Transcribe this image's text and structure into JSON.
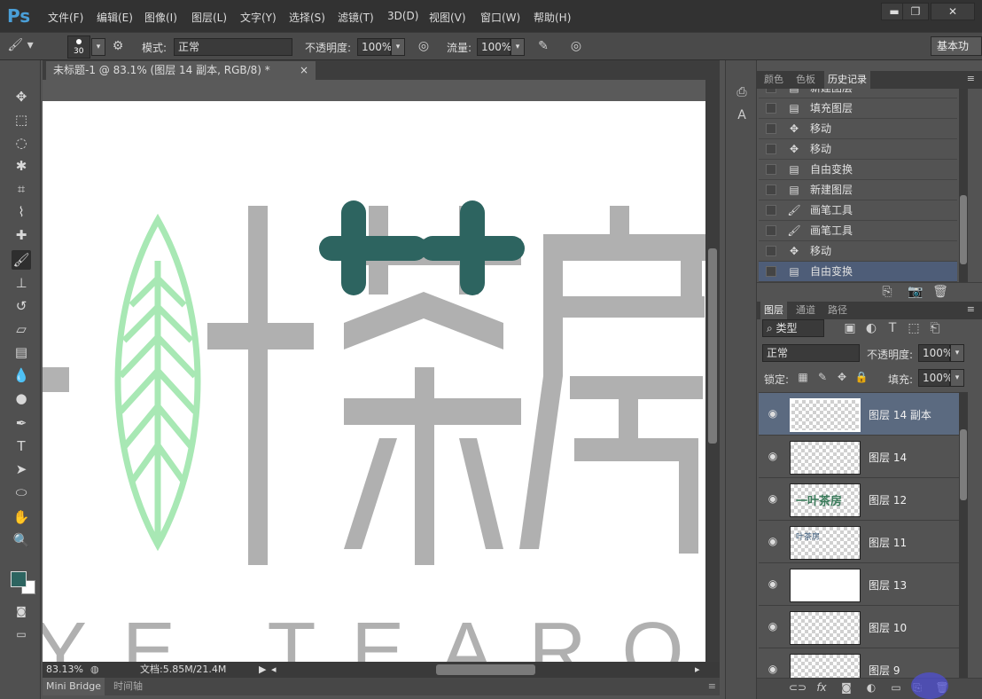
{
  "app": {
    "logo": "Ps"
  },
  "menu": [
    "文件(F)",
    "编辑(E)",
    "图像(I)",
    "图层(L)",
    "文字(Y)",
    "选择(S)",
    "滤镜(T)",
    "3D(D)",
    "视图(V)",
    "窗口(W)",
    "帮助(H)"
  ],
  "window_controls": {
    "minimize": "▬",
    "restore": "❐",
    "close": "✕"
  },
  "options": {
    "brush_size": "30",
    "mode_label": "模式:",
    "mode_value": "正常",
    "opacity_label": "不透明度:",
    "opacity_value": "100%",
    "flow_label": "流量:",
    "flow_value": "100%",
    "workspace": "基本功"
  },
  "document": {
    "tab_title": "未标题-1 @ 83.1% (图层 14 副本, RGB/8) *",
    "close": "×",
    "zoom": "83.13%",
    "doc_info": "文档:5.85M/21.4M"
  },
  "bottom_tabs": [
    "Mini Bridge",
    "时间轴"
  ],
  "canvas": {
    "logo_chars": "一叶茶房",
    "subtitle": "YE TEAROOM",
    "leaf_color": "#a8e8b4",
    "text_color": "#b0b0b0",
    "stroke_color": "#2d6460"
  },
  "colors": {
    "foreground": "#2d6460",
    "background": "#ffffff",
    "selection": "#4e5d78"
  },
  "history_panel": {
    "tabs": [
      "颜色",
      "色板",
      "历史记录"
    ],
    "active_tab": "历史记录",
    "items": [
      {
        "label": "新建图层",
        "icon": "doc-icon"
      },
      {
        "label": "填充图层",
        "icon": "doc-icon"
      },
      {
        "label": "移动",
        "icon": "move-icon"
      },
      {
        "label": "移动",
        "icon": "move-icon"
      },
      {
        "label": "自由变换",
        "icon": "doc-icon"
      },
      {
        "label": "新建图层",
        "icon": "doc-icon"
      },
      {
        "label": "画笔工具",
        "icon": "brush-icon"
      },
      {
        "label": "画笔工具",
        "icon": "brush-icon"
      },
      {
        "label": "移动",
        "icon": "move-icon"
      },
      {
        "label": "自由变换",
        "icon": "doc-icon",
        "selected": true
      }
    ]
  },
  "layers_panel": {
    "tabs": [
      "图层",
      "通道",
      "路径"
    ],
    "active_tab": "图层",
    "filter_value": "类型",
    "blend_mode": "正常",
    "opacity_label": "不透明度:",
    "opacity_value": "100%",
    "lock_label": "锁定:",
    "fill_label": "填充:",
    "fill_value": "100%",
    "layers": [
      {
        "name": "图层 14 副本",
        "selected": true,
        "thumb": "transparent"
      },
      {
        "name": "图层 14",
        "thumb": "transparent"
      },
      {
        "name": "图层 12",
        "thumb": "logo"
      },
      {
        "name": "图层 11",
        "thumb": "logo-small"
      },
      {
        "name": "图层 13",
        "thumb": "white"
      },
      {
        "name": "图层 10",
        "thumb": "transparent"
      },
      {
        "name": "图层 9",
        "thumb": "transparent"
      }
    ]
  }
}
